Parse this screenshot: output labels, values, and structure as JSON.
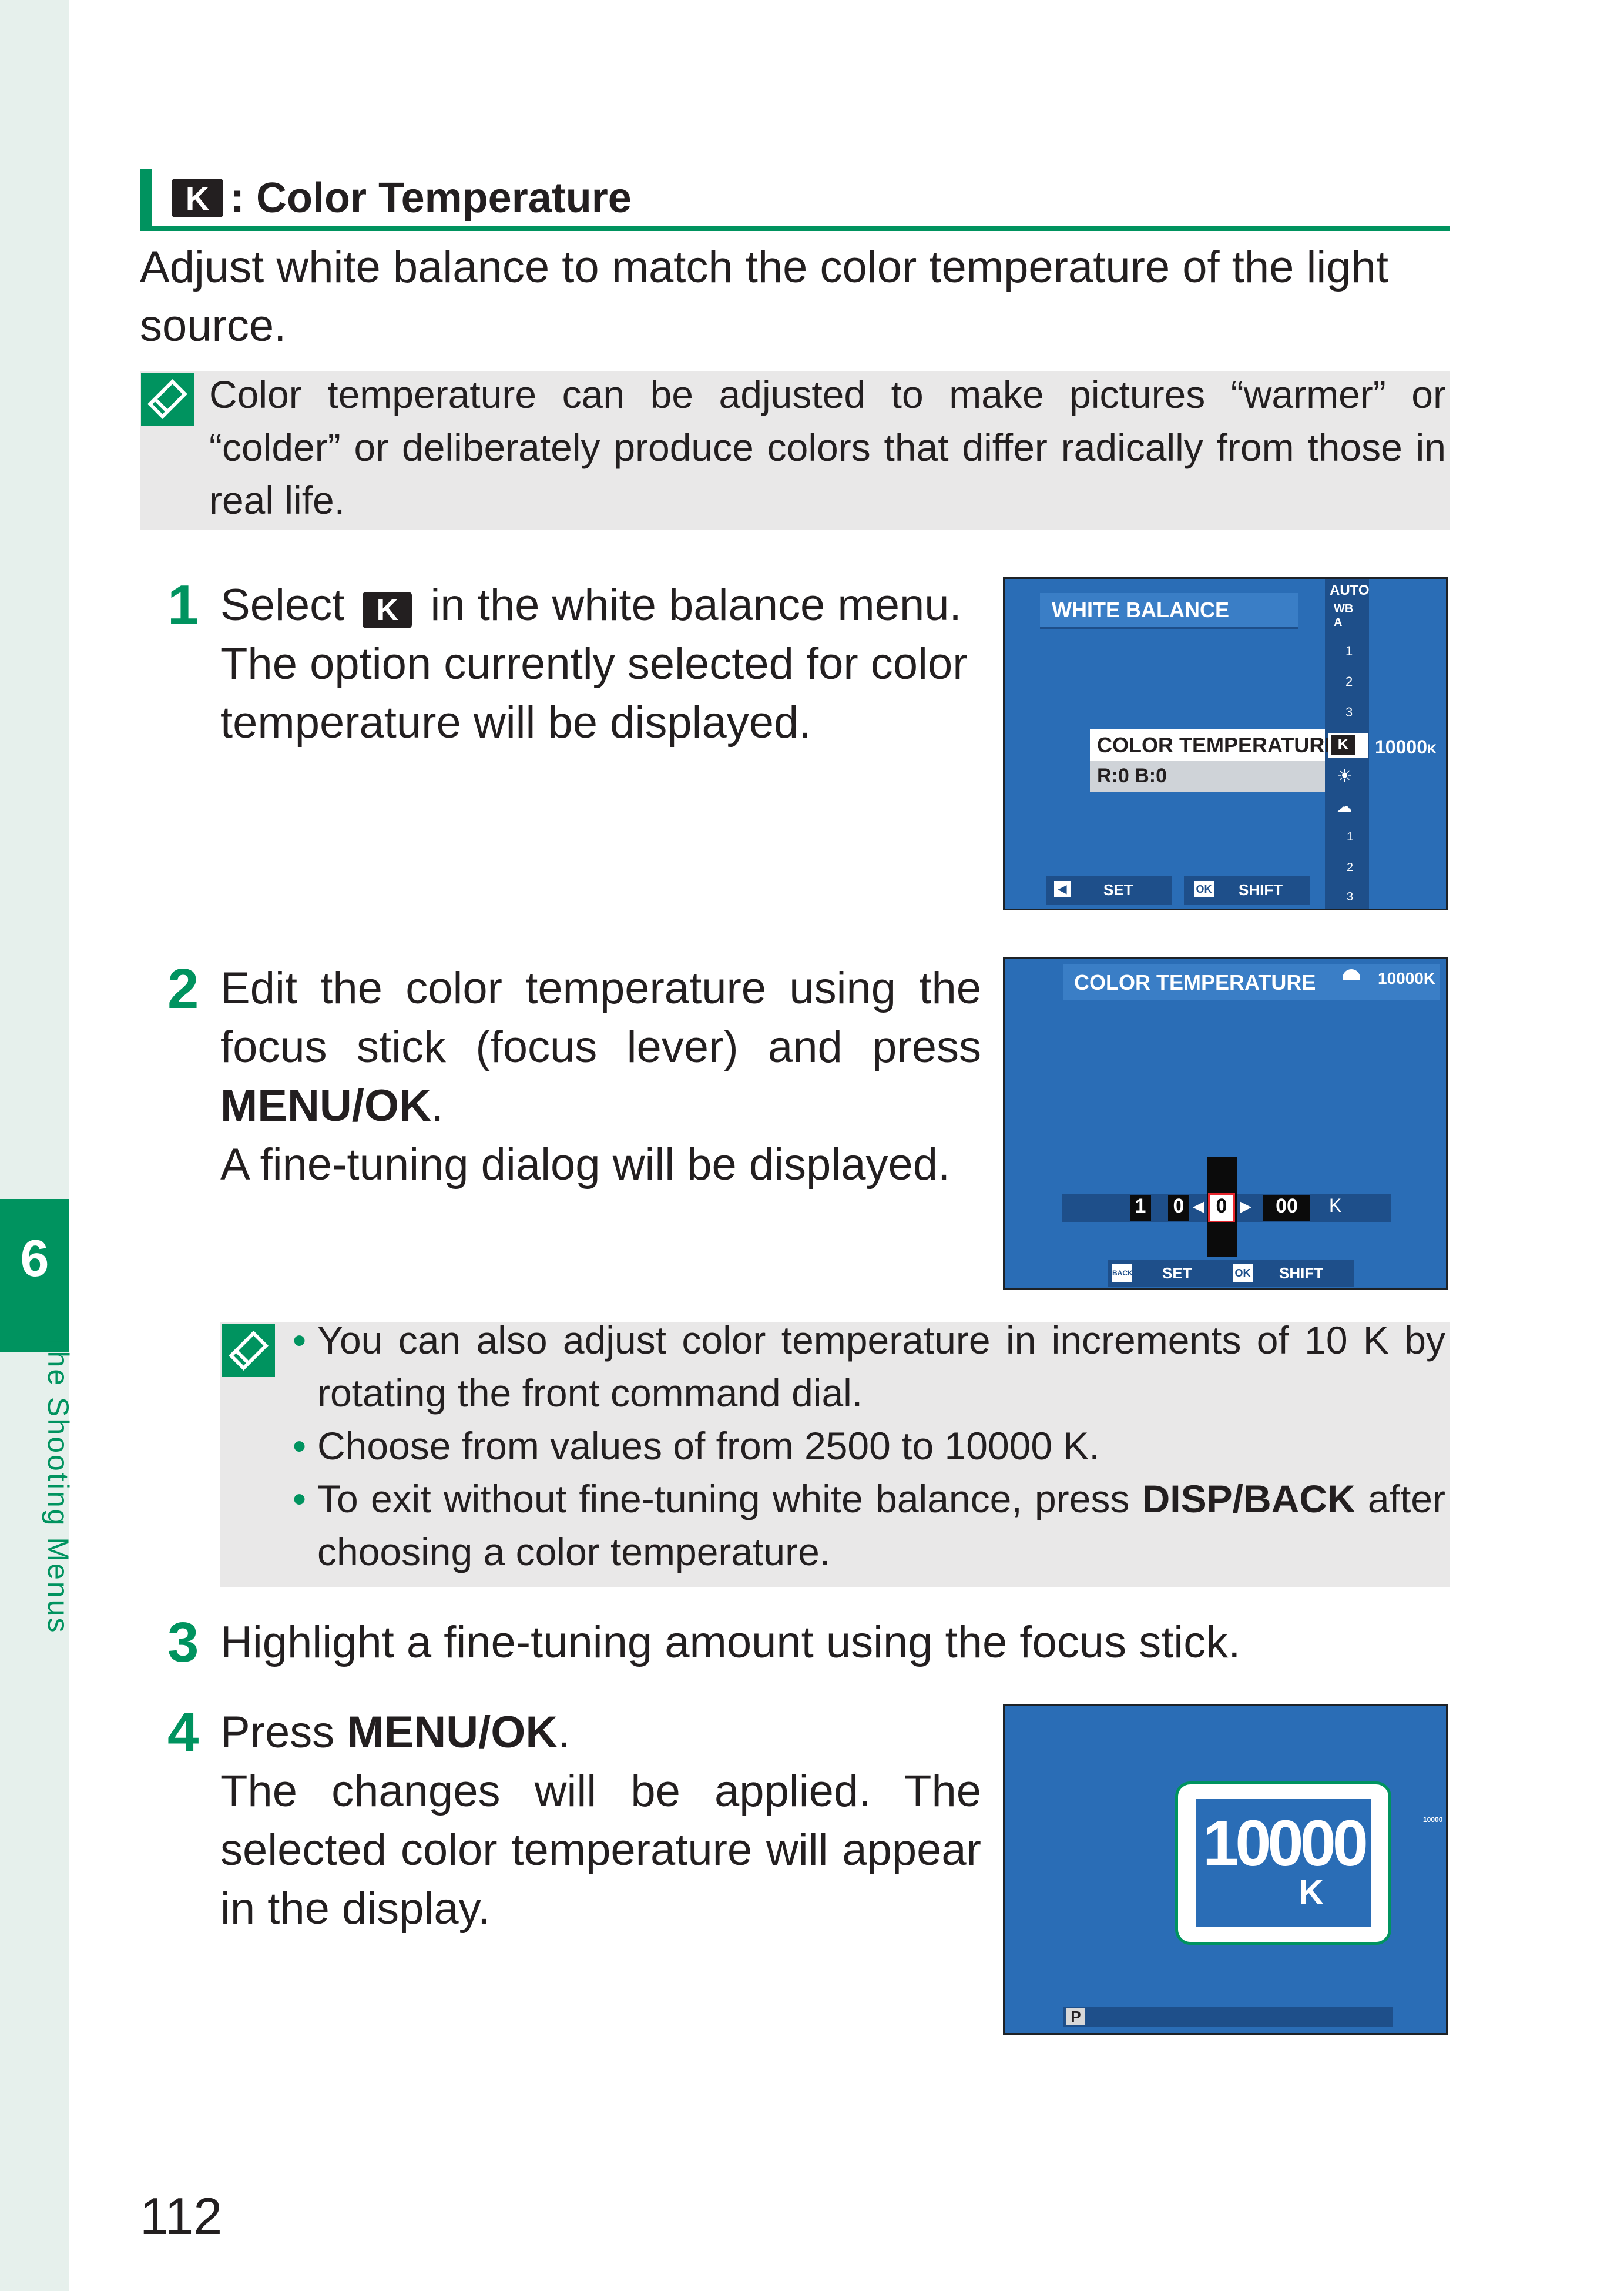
{
  "sidebar": {
    "chapter_number": "6",
    "chapter_title": "The Shooting Menus"
  },
  "section": {
    "icon_letter": "K",
    "title": ": Color Temperature"
  },
  "intro": "Adjust white balance to match the color temperature of the light source.",
  "note_top": "Color temperature can be adjusted to make pictures “warmer” or “colder” or deliberately produce colors that differ radically from those in real life.",
  "step1": {
    "number": "1",
    "text_before": "Select",
    "icon_letter": "K",
    "text_after": "in the white balance menu.",
    "detail": "The option currently selected for color temperature will be displayed."
  },
  "step2": {
    "number": "2",
    "text": "Edit the color temperature using the focus stick (focus lever) and press",
    "button": "MENU/OK",
    "end": ".",
    "detail": "A fine-tuning dialog will be displayed."
  },
  "note_mid": {
    "bullets": [
      "You can also adjust color temperature in increments of 10 K by rotating the front command dial.",
      "Choose from values of from 2500 to 10000 K."
    ],
    "bullet3_before": "To exit without fine-tuning white balance, press",
    "bullet3_button": "DISP/BACK",
    "bullet3_after": "after choosing a color temperature."
  },
  "step3": {
    "number": "3",
    "text": "Highlight a fine-tuning amount using the focus stick."
  },
  "step4": {
    "number": "4",
    "text_before": "Press",
    "button": "MENU/OK",
    "end": ".",
    "detail": "The changes will be applied. The selected color temperature will appear in the display."
  },
  "screen1": {
    "title": "WHITE BALANCE",
    "item_label": "COLOR TEMPERATURE",
    "item_sub": "R:0  B:0",
    "value": "10000",
    "value_unit": "K",
    "icons": [
      "AUTO",
      "WB A",
      "1",
      "2",
      "3",
      "K",
      "☀",
      "☁",
      "1",
      "2",
      "3"
    ],
    "footer_set": "SET",
    "footer_shift": "SHIFT",
    "footer_ok": "OK"
  },
  "screen2": {
    "title": "COLOR TEMPERATURE",
    "value": "10000K",
    "digits": [
      "1",
      "0",
      "0",
      "00"
    ],
    "unit": "K",
    "footer_back": "BACK",
    "footer_set": "SET",
    "footer_ok": "OK",
    "footer_shift": "SHIFT"
  },
  "screen3": {
    "value": "10000",
    "unit": "K",
    "small_value": "10000",
    "mode": "P"
  },
  "page_number": "112",
  "colors": {
    "accent": "#00935f",
    "screen_bg": "#2a6db6",
    "note_bg": "#e9e8e8"
  }
}
